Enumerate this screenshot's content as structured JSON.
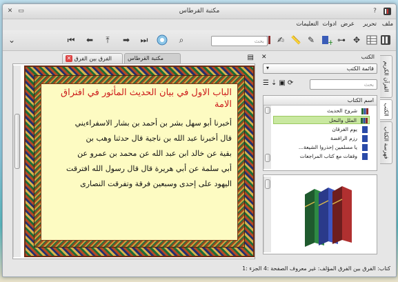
{
  "window": {
    "title": "مكتبة القرطاس"
  },
  "menu": {
    "items": [
      "ملف",
      "تحرير",
      "عرض",
      "ادوات",
      "التعليمات"
    ]
  },
  "toolbar": {
    "search_left_placeholder": "بحث"
  },
  "tabs": [
    {
      "label": "الفرق بين الفرق",
      "active": true
    },
    {
      "label": "مكتبة القرطاس",
      "active": false
    }
  ],
  "page": {
    "chapter_title": "الباب الاول في بيان الحديث المأثور في افتراق الامة",
    "body_lines": [
      "أخبرنا أبو سهل بشر بن أحمد بن بشار الاسفراءيني",
      "قال أخبرنا عبد الله بن ناجية قال حدثنا وهب بن",
      "بقية عن خالد ابن عبد الله عن محمد بن عمرو عن",
      "أبي سلمة عن أبي هريرة قال قال رسول الله افترقت",
      "اليهود على إحدى وسبعين فرقة وتفرقت النصارى"
    ]
  },
  "dock": {
    "title": "الكتب",
    "list_combo": "قائمة الكتب",
    "search_placeholder": "بحث",
    "tree_header": "اسم الكتاب",
    "tree_rows": [
      {
        "label": "شروح الحديث",
        "selected": false
      },
      {
        "label": "الملل والنحل",
        "selected": true
      },
      {
        "label": "يوم الفرقان",
        "selected": false
      },
      {
        "label": "رزم الرافضة",
        "selected": false
      },
      {
        "label": "يا مسلمين إحذروا الشيعة...",
        "selected": false
      },
      {
        "label": "وقفات مع كتاب المراجعات",
        "selected": false
      }
    ]
  },
  "sidetabs": [
    "القرآن الكريم",
    "الكتب",
    "فهرسة الكتاب"
  ],
  "status": {
    "text": "كتاب: الفرق بين الفرق  المؤلف: غير معروف  الصفحة :4  الجزء :1"
  },
  "colors": {
    "selected_row": "#c9e8a0",
    "chapter_red": "#cc1a1a",
    "page_bg": "#fdfbc2"
  }
}
